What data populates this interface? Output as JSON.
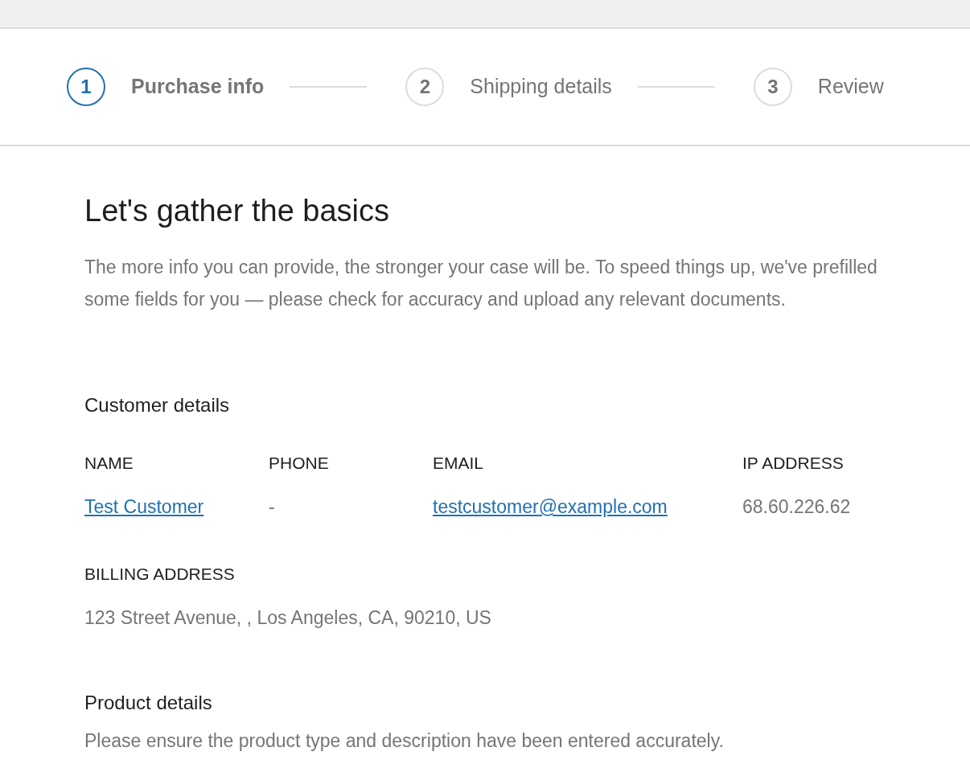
{
  "steps": [
    {
      "number": "1",
      "label": "Purchase info",
      "selected": true
    },
    {
      "number": "2",
      "label": "Shipping details",
      "selected": false
    },
    {
      "number": "3",
      "label": "Review",
      "selected": false
    }
  ],
  "heading": "Let's gather the basics",
  "intro": "The more info you can provide, the stronger your case will be. To speed things up, we've prefilled some fields for you — please check for accuracy and upload any relevant documents.",
  "customer_details": {
    "title": "Customer details",
    "fields": [
      {
        "label": "NAME",
        "value": "Test Customer",
        "kind": "link"
      },
      {
        "label": "PHONE",
        "value": "-",
        "kind": "text"
      },
      {
        "label": "EMAIL",
        "value": "testcustomer@example.com",
        "kind": "link"
      },
      {
        "label": "IP ADDRESS",
        "value": "68.60.226.62",
        "kind": "text"
      }
    ],
    "billing": {
      "label": "BILLING ADDRESS",
      "value": "123 Street Avenue, , Los Angeles, CA, 90210, US"
    }
  },
  "product_details": {
    "title": "Product details",
    "description": "Please ensure the product type and description have been entered accurately."
  }
}
